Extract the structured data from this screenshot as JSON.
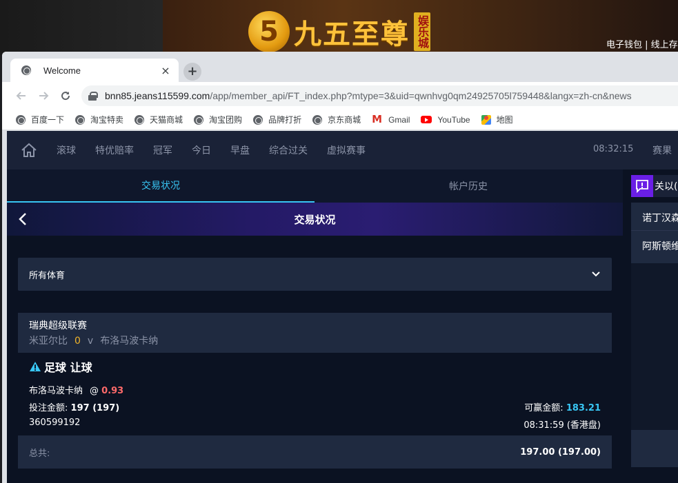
{
  "background_site": {
    "brand_text": "九五至尊",
    "brand_tag": "娱乐城",
    "links": "电子钱包 | 线上存"
  },
  "browser": {
    "tab": {
      "title": "Welcome",
      "close": "×"
    },
    "new_tab": "+",
    "url_host": "bnn85.jeans115599.com",
    "url_path": "/app/member_api/FT_index.php?mtype=3&uid=qwnhvg0qm24925705l759448&langx=zh-cn&news",
    "bookmarks": [
      {
        "label": "百度一下",
        "icon": "globe-icon"
      },
      {
        "label": "淘宝特卖",
        "icon": "globe-icon"
      },
      {
        "label": "天猫商城",
        "icon": "globe-icon"
      },
      {
        "label": "淘宝团购",
        "icon": "globe-icon"
      },
      {
        "label": "品牌打折",
        "icon": "globe-icon"
      },
      {
        "label": "京东商城",
        "icon": "globe-icon"
      },
      {
        "label": "Gmail",
        "icon": "gmail-icon"
      },
      {
        "label": "YouTube",
        "icon": "youtube-icon"
      },
      {
        "label": "地图",
        "icon": "maps-icon"
      }
    ]
  },
  "site": {
    "nav": [
      "滚球",
      "特优赔率",
      "冠军",
      "今日",
      "早盘",
      "综合过关",
      "虚拟赛事"
    ],
    "clock": "08:32:15",
    "results": "赛果",
    "tabs": {
      "active": "交易状况",
      "inactive": "帐户历史"
    },
    "page_title": "交易状况",
    "filter": {
      "selected": "所有体育"
    },
    "bet": {
      "league": "瑞典超级联赛",
      "home": "米亚尔比",
      "score": "0",
      "vs": "v",
      "away": "布洛马波卡纳",
      "type": "足球 让球",
      "selection": "布洛马波卡纳",
      "at": "@",
      "odds": "0.93",
      "stake_label": "投注金额:",
      "stake_value": "197 (197)",
      "win_label": "可赢金额:",
      "win_value": "183.21",
      "ticket_id": "360599192",
      "time": "08:31:59 (香港盘)"
    },
    "total": {
      "label": "总共:",
      "value": "197.00 (197.00)"
    },
    "side": {
      "title": "关以(",
      "items": [
        "诺丁汉森",
        "阿斯顿维"
      ]
    }
  },
  "colors": {
    "accent": "#38c6f4",
    "odds": "#ff6a6a",
    "score": "#f0b429",
    "nav_bg": "#1a2237",
    "page_bg": "#0b1222",
    "card_bg": "#1f2a40",
    "side_icon": "#6a1fe6"
  }
}
